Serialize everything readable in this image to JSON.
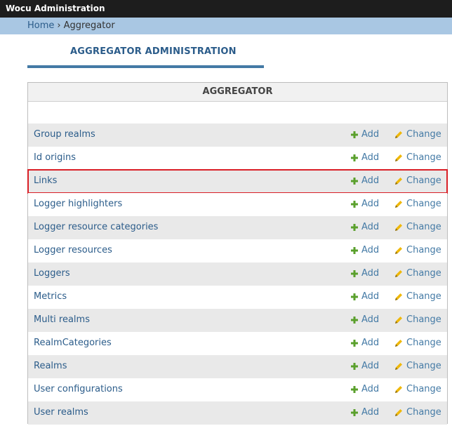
{
  "app": {
    "title": "Wocu Administration"
  },
  "breadcrumb": {
    "home": "Home",
    "separator": "›",
    "current": "Aggregator"
  },
  "page": {
    "title": "AGGREGATOR ADMINISTRATION"
  },
  "module": {
    "caption": "AGGREGATOR",
    "add_label": "Add",
    "change_label": "Change",
    "rows": [
      {
        "name": "Group realms"
      },
      {
        "name": "Id origins"
      },
      {
        "name": "Links",
        "highlighted": true
      },
      {
        "name": "Logger highlighters"
      },
      {
        "name": "Logger resource categories"
      },
      {
        "name": "Logger resources"
      },
      {
        "name": "Loggers"
      },
      {
        "name": "Metrics"
      },
      {
        "name": "Multi realms"
      },
      {
        "name": "RealmCategories"
      },
      {
        "name": "Realms"
      },
      {
        "name": "User configurations"
      },
      {
        "name": "User realms"
      }
    ]
  },
  "colors": {
    "header_bg": "#1d1d1d",
    "breadcrumb_bg": "#a9c7e3",
    "link": "#2b5c8a",
    "add_icon": "#5aa02c",
    "change_icon": "#efb80b",
    "highlight": "#d91f26"
  }
}
